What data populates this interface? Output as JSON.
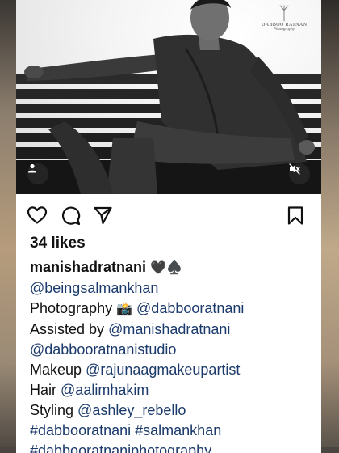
{
  "post": {
    "likes": "34 likes",
    "username": "manishadratnani",
    "username_emoji": "🖤♠️",
    "caption": {
      "line1": "@beingsalmankhan",
      "photography_label": "Photography",
      "photography_emoji": "📸",
      "photography_tag": "@dabbooratnani",
      "assisted_label": "Assisted by",
      "assisted_tag": "@manishadratnani",
      "studio_tag": "@dabbooratnanistudio",
      "makeup_label": "Makeup",
      "makeup_tag": "@rajunaagmakeupartist",
      "hair_label": "Hair",
      "hair_tag": "@aalimhakim",
      "styling_label": "Styling",
      "styling_tag": "@ashley_rebello",
      "hashtag1": "#dabbooratnani",
      "hashtag2": "#salmankhan",
      "hashtag3": "#dabbooratnaniphotography"
    }
  },
  "watermark": {
    "line1": "DABBOO RATNANI",
    "line2": "Photography"
  },
  "icons": {
    "like": "heart-icon",
    "comment": "comment-icon",
    "share": "send-icon",
    "save": "bookmark-icon",
    "tagged_user": "user-icon",
    "mute": "muted-speaker-icon"
  }
}
